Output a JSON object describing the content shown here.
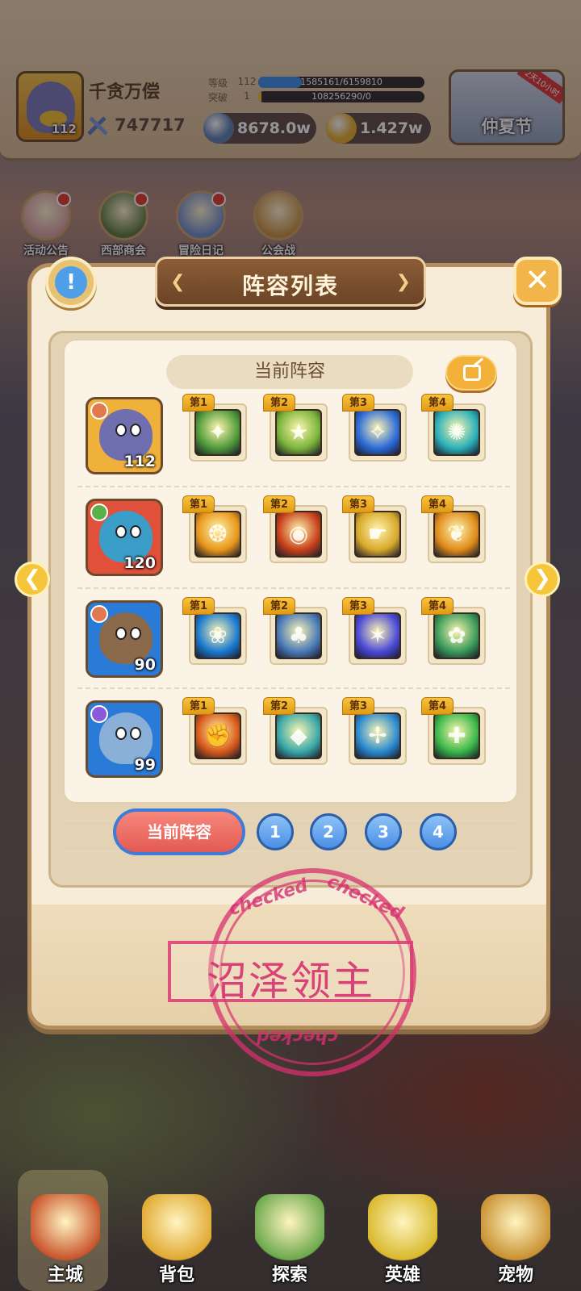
{
  "header": {
    "player_name": "千贪万偿",
    "avatar_level": "112",
    "power": "747717",
    "stats": [
      {
        "label": "等级",
        "value": "112",
        "bar_text": "1585161/6159810",
        "progress": 0.26,
        "color": "#3c8fe8"
      },
      {
        "label": "突破",
        "value": "1",
        "bar_text": "108256290/0",
        "progress": 0.02,
        "color": "#f2c230"
      }
    ],
    "currencies": [
      {
        "icon": "diamond-coin-icon",
        "value": "8678.0w",
        "color": "#5d7fb0"
      },
      {
        "icon": "gold-coin-icon",
        "value": "1.427w",
        "color": "#e3a92a"
      }
    ],
    "event": {
      "label": "仲夏节",
      "tag": "2天10小时"
    }
  },
  "top_icons": [
    {
      "name": "activity-notice",
      "label": "活动公告",
      "color": "#d8a0a0"
    },
    {
      "name": "western-shop",
      "label": "西部商会",
      "color": "#5a7a3a"
    },
    {
      "name": "adventure-diary",
      "label": "冒险日记",
      "color": "#6a8ac8"
    },
    {
      "name": "guild-war",
      "label": "公会战",
      "color": "#c89040"
    }
  ],
  "modal": {
    "title": "阵容列表",
    "current_lineup_label": "当前阵容",
    "rows": [
      {
        "hero": {
          "level": "112",
          "bg": "#f0b13a",
          "blob": "#6f6fb0",
          "elem": "#e07850"
        },
        "skills": [
          {
            "tag": "第1",
            "color": "#4f9a3a",
            "symbol": "✦"
          },
          {
            "tag": "第2",
            "color": "#7ab43a",
            "symbol": "★"
          },
          {
            "tag": "第3",
            "color": "#2a6ad8",
            "symbol": "✧"
          },
          {
            "tag": "第4",
            "color": "#2ab0b8",
            "symbol": "✺"
          }
        ]
      },
      {
        "hero": {
          "level": "120",
          "bg": "#e0503a",
          "blob": "#3a9ec8",
          "elem": "#5cb04a"
        },
        "skills": [
          {
            "tag": "第1",
            "color": "#e8961a",
            "symbol": "❂"
          },
          {
            "tag": "第2",
            "color": "#c8401a",
            "symbol": "◉"
          },
          {
            "tag": "第3",
            "color": "#d8a82a",
            "symbol": "☛"
          },
          {
            "tag": "第4",
            "color": "#e08a1a",
            "symbol": "❦"
          }
        ]
      },
      {
        "hero": {
          "level": "90",
          "bg": "#2a7ad8",
          "blob": "#8a6a4a",
          "elem": "#e07850"
        },
        "skills": [
          {
            "tag": "第1",
            "color": "#1a7ad0",
            "symbol": "❀"
          },
          {
            "tag": "第2",
            "color": "#4a7ab8",
            "symbol": "♣"
          },
          {
            "tag": "第3",
            "color": "#4a4ad8",
            "symbol": "✶"
          },
          {
            "tag": "第4",
            "color": "#3a9a5a",
            "symbol": "✿"
          }
        ]
      },
      {
        "hero": {
          "level": "99",
          "bg": "#2a7ad8",
          "blob": "#8ab0d8",
          "elem": "#8a5ad8"
        },
        "skills": [
          {
            "tag": "第1",
            "color": "#d85a1a",
            "symbol": "✊"
          },
          {
            "tag": "第2",
            "color": "#3aa8a8",
            "symbol": "◆"
          },
          {
            "tag": "第3",
            "color": "#2a8ad0",
            "symbol": "✢"
          },
          {
            "tag": "第4",
            "color": "#3ab84a",
            "symbol": "✚"
          }
        ]
      }
    ],
    "tabs": {
      "current": "当前阵容",
      "numbers": [
        "1",
        "2",
        "3",
        "4"
      ]
    }
  },
  "stamp": {
    "word": "checked",
    "name": "沼泽领主"
  },
  "bottom_nav": [
    {
      "name": "main-city",
      "label": "主城",
      "color": "#c8522a"
    },
    {
      "name": "backpack",
      "label": "背包",
      "color": "#e0a830"
    },
    {
      "name": "explore",
      "label": "探索",
      "color": "#6aa84a"
    },
    {
      "name": "heroes",
      "label": "英雄",
      "color": "#d8b82a"
    },
    {
      "name": "pets",
      "label": "宠物",
      "color": "#c89030"
    }
  ]
}
